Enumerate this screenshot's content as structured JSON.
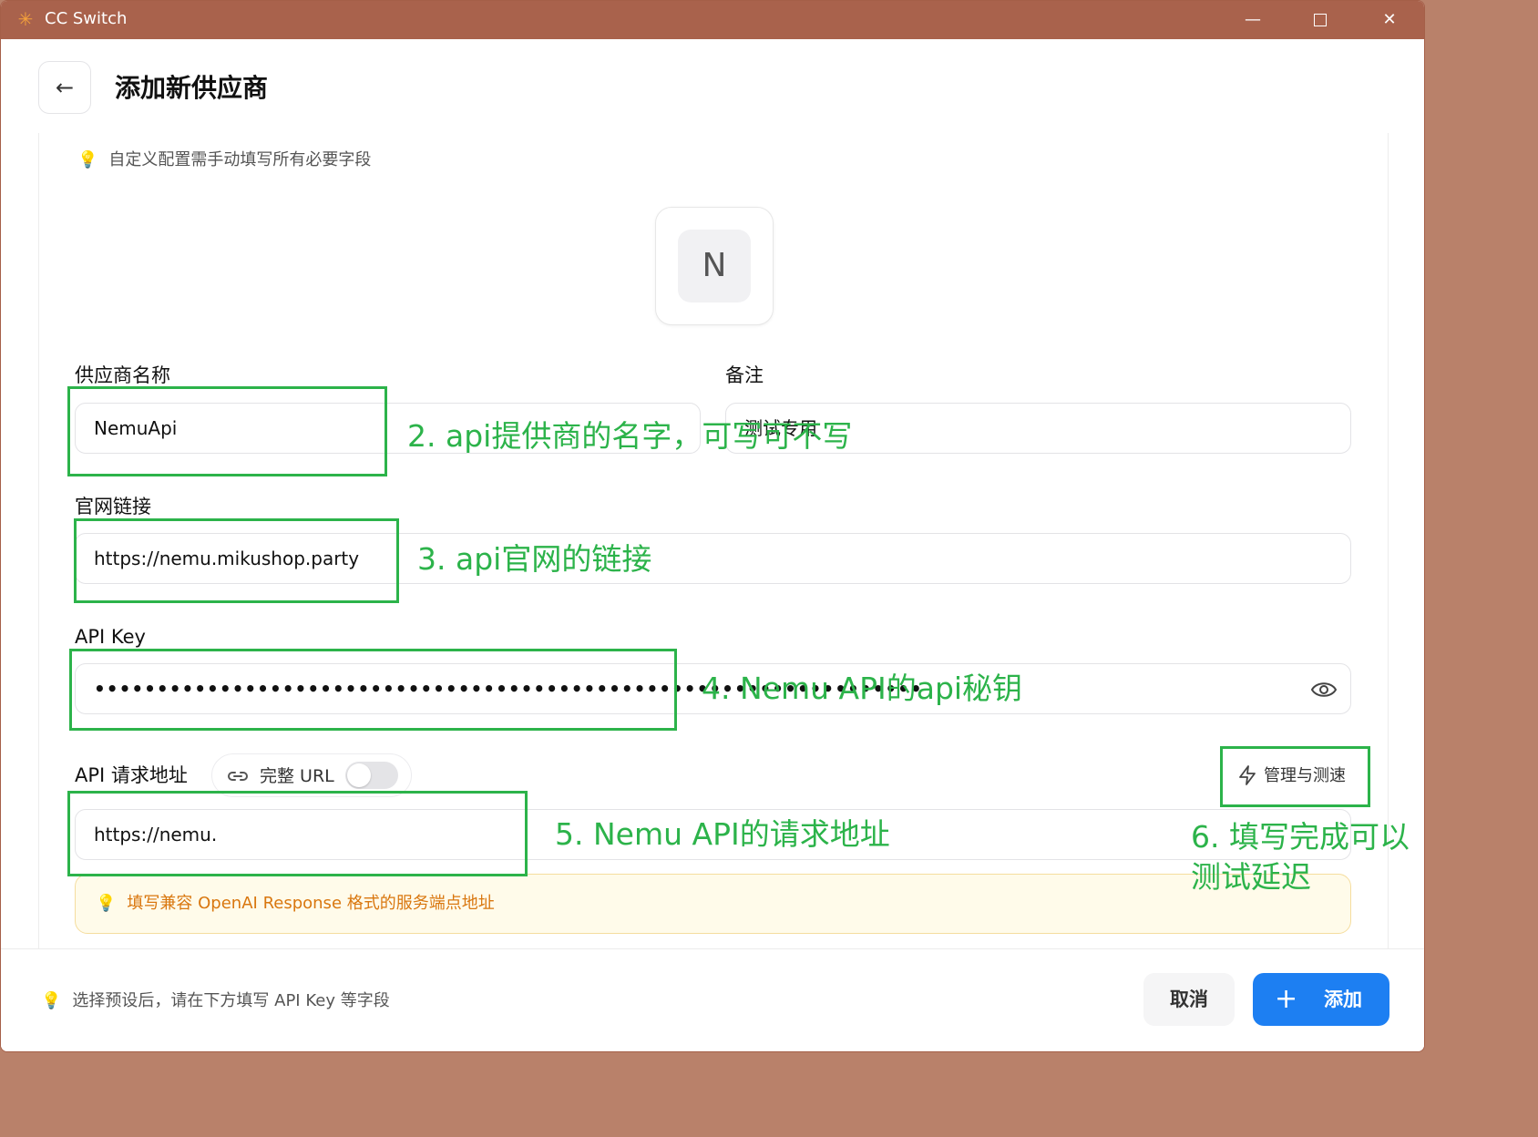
{
  "window": {
    "title": "CC Switch",
    "min_symbol": "—",
    "close_symbol": "✕",
    "app_icon": "✳"
  },
  "header": {
    "back_symbol": "←",
    "title": "添加新供应商"
  },
  "hint_top": "自定义配置需手动填写所有必要字段",
  "logo_letter": "N",
  "fields": {
    "provider_name": {
      "label": "供应商名称",
      "value": "NemuApi"
    },
    "notes": {
      "label": "备注",
      "value": "测试专用"
    },
    "website": {
      "label": "官网链接",
      "value": "https://nemu.mikushop.party"
    },
    "api_key": {
      "label": "API Key",
      "value": "••••••••••••••••••••••••••••••••••••••••••••••••••••••••••••••••••"
    },
    "api_url": {
      "label": "API 请求地址",
      "value": "https://nemu."
    }
  },
  "full_url_toggle": {
    "label": "完整 URL",
    "on": false
  },
  "manage_button": {
    "label": "管理与测速"
  },
  "note": "填写兼容 OpenAI Response 格式的服务端点地址",
  "footer": {
    "hint": "选择预设后，请在下方填写 API Key 等字段",
    "cancel_label": "取消",
    "add_label": "添加",
    "add_symbol": "+"
  },
  "annotations": {
    "a2": "2. api提供商的名字，可写可不写",
    "a3": "3. api官网的链接",
    "a4": "4. Nemu API的api秘钥",
    "a5": "5. Nemu API的请求地址",
    "a6": "6. 填写完成可以测试延迟"
  },
  "colors": {
    "titlebar": "#a9624c",
    "accent": "#1d7ff2",
    "annotation": "#2cb34a",
    "note_text": "#d9770f"
  }
}
